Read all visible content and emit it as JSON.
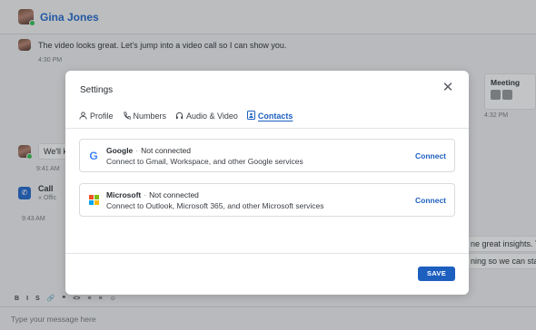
{
  "chat": {
    "contact_name": "Gina Jones",
    "messages": [
      {
        "text": "The video looks great. Let's jump into a video call so I can show you.",
        "time": "4:30 PM"
      },
      {
        "text": "We'll k",
        "time": "9:41 AM"
      },
      {
        "title": "Call",
        "subtitle": "Offic",
        "time": "9:43 AM"
      }
    ],
    "side_card": {
      "title": "Meeting",
      "time": "4:32 PM"
    },
    "right_snippets": [
      "ne great insights. T",
      "ning so we can star"
    ],
    "toolbar": [
      "B",
      "I",
      "S",
      "🔗",
      "❝",
      "<>",
      "≡",
      "≡",
      "☺"
    ],
    "compose_placeholder": "Type your message here"
  },
  "modal": {
    "title": "Settings",
    "tabs": [
      {
        "label": "Profile",
        "icon": "person-icon"
      },
      {
        "label": "Numbers",
        "icon": "phone-icon"
      },
      {
        "label": "Audio & Video",
        "icon": "headphones-icon"
      },
      {
        "label": "Contacts",
        "icon": "contacts-icon",
        "active": true
      }
    ],
    "integrations": [
      {
        "name": "Google",
        "status": "Not connected",
        "description": "Connect to Gmail, Workspace, and other Google services",
        "action": "Connect",
        "logo_char": "G"
      },
      {
        "name": "Microsoft",
        "status": "Not connected",
        "description": "Connect to Outlook, Microsoft 365, and other Microsoft services",
        "action": "Connect"
      }
    ],
    "save_label": "SAVE"
  },
  "colors": {
    "accent": "#1d5fbf",
    "ms_red": "#f25022",
    "ms_green": "#7fba00",
    "ms_blue": "#00a4ef",
    "ms_yellow": "#ffb900"
  }
}
